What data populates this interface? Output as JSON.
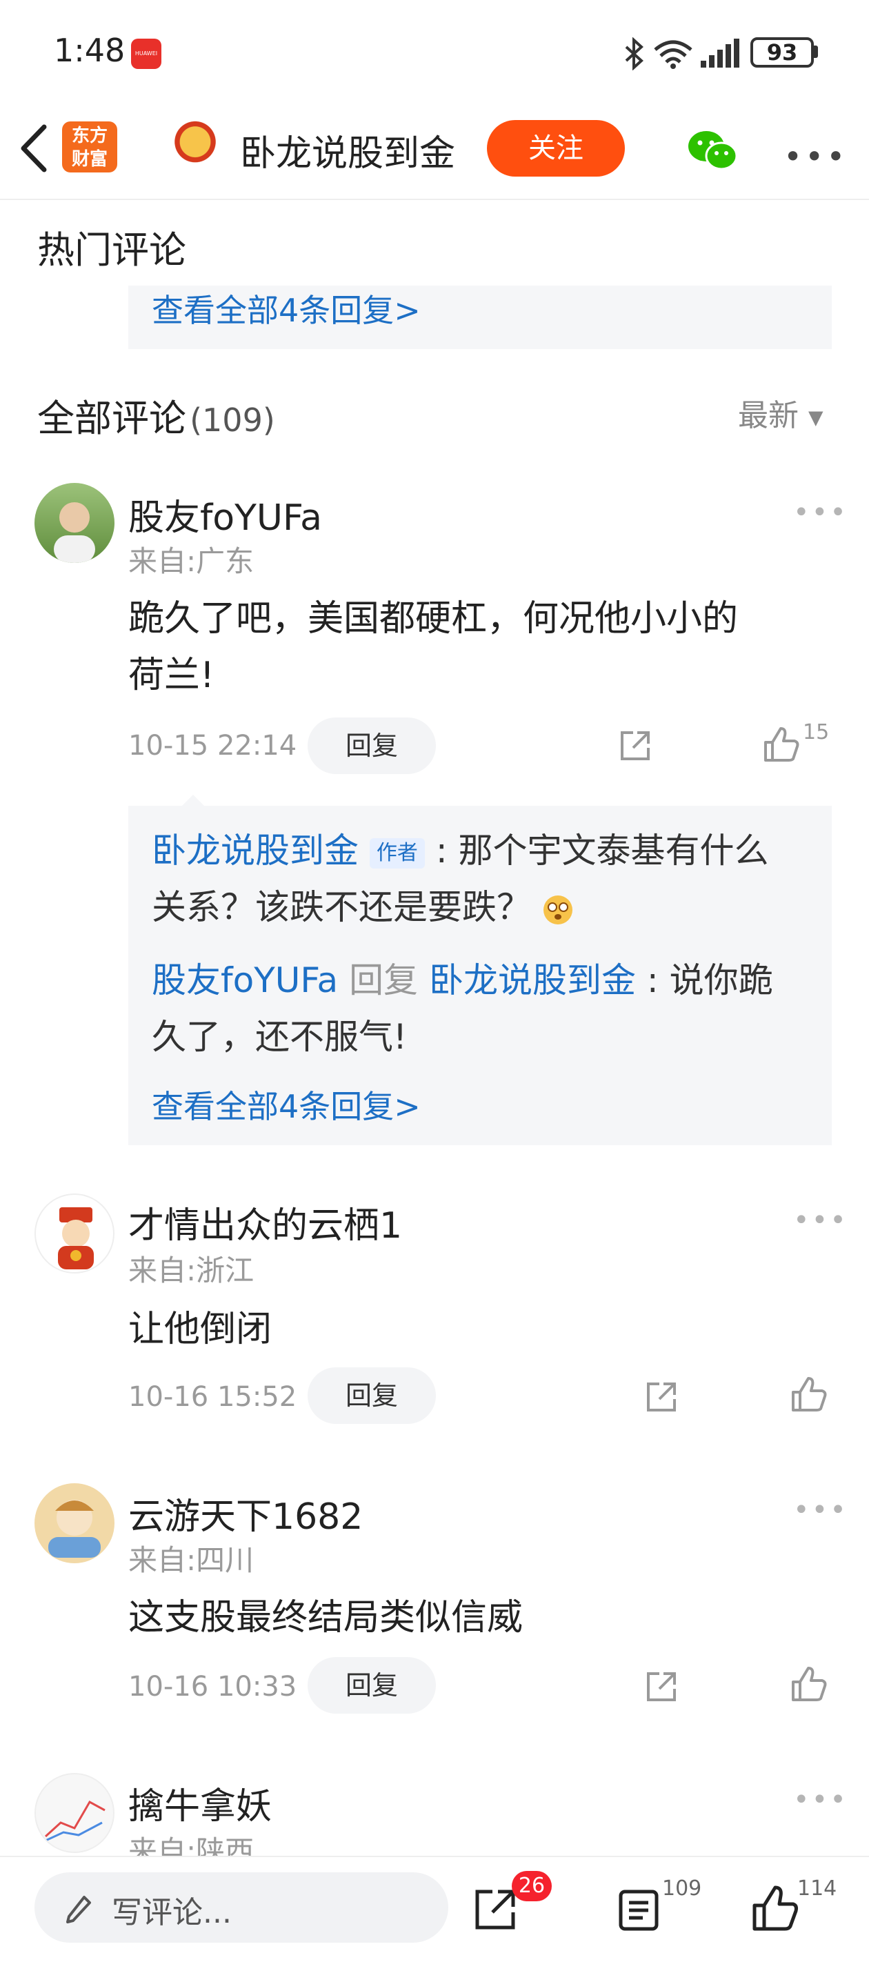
{
  "status_bar": {
    "time": "1:48",
    "brand_badge": "HUAWEI",
    "battery": "93"
  },
  "header": {
    "logo_line1": "东方",
    "logo_line2": "财富",
    "title": "卧龙说股到金",
    "follow_label": "关注"
  },
  "hot_comments": {
    "title": "热门评论",
    "view_all": "查看全部4条回复>"
  },
  "all_comments": {
    "title": "全部评论",
    "count": "(109)",
    "sort_label": "最新"
  },
  "comments": [
    {
      "user": "股友foYUFa",
      "from": "来自:广东",
      "text_line1": "跪久了吧，美国都硬杠，何况他小小的",
      "text_line2": "荷兰!",
      "time": "10-15 22:14",
      "reply_label": "回复",
      "like_count": "15",
      "replies": {
        "r1_name": "卧龙说股到金",
        "r1_tag": "作者",
        "r1_text_a": ": 那个宇文泰基有什么",
        "r1_text_b": "关系？该跌不还是要跌？",
        "r2_name": "股友foYUFa",
        "r2_mid": "回复",
        "r2_target": "卧龙说股到金",
        "r2_text_a": ": 说你跪",
        "r2_text_b": "久了，还不服气!",
        "view_all": "查看全部4条回复>"
      }
    },
    {
      "user": "才情出众的云栖1",
      "from": "来自:浙江",
      "text_line1": "让他倒闭",
      "time": "10-16 15:52",
      "reply_label": "回复"
    },
    {
      "user": "云游天下1682",
      "from": "来自:四川",
      "text_line1": "这支股最终结局类似信威",
      "time": "10-16 10:33",
      "reply_label": "回复"
    },
    {
      "user": "擒牛拿妖",
      "from": "来自:陕西"
    }
  ],
  "bottom_bar": {
    "input_placeholder": "写评论...",
    "share_badge": "26",
    "comment_count": "109",
    "like_count": "114"
  },
  "colors": {
    "accent_orange": "#ff4f0f",
    "link_blue": "#1d6fc5",
    "badge_red": "#f5222d"
  }
}
